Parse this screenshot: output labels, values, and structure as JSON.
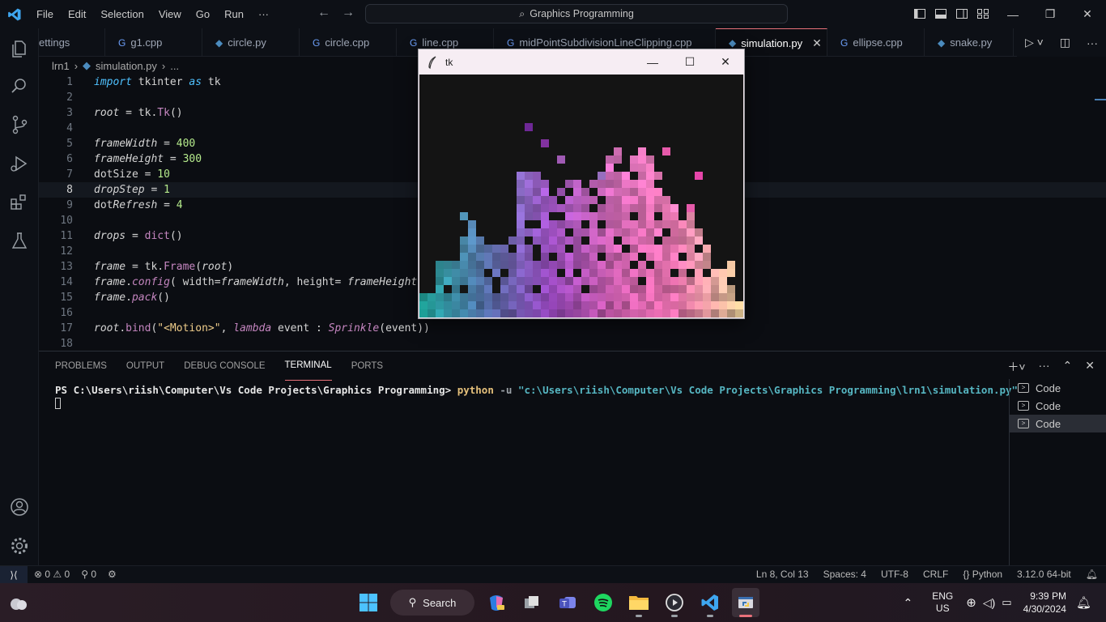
{
  "titlebar": {
    "menu": [
      "File",
      "Edit",
      "Selection",
      "View",
      "Go",
      "Run",
      "···"
    ],
    "search_text": "Graphics Programming"
  },
  "tabs": [
    {
      "label": "ettings",
      "active": false
    },
    {
      "label": "g1.cpp",
      "active": false
    },
    {
      "label": "circle.py",
      "active": false
    },
    {
      "label": "circle.cpp",
      "active": false
    },
    {
      "label": "line.cpp",
      "active": false
    },
    {
      "label": "midPointSubdivisionLineClipping.cpp",
      "active": false
    },
    {
      "label": "simulation.py",
      "active": true
    },
    {
      "label": "ellipse.cpp",
      "active": false
    },
    {
      "label": "snake.py",
      "active": false
    }
  ],
  "breadcrumb": {
    "folder": "lrn1",
    "file": "simulation.py",
    "more": "..."
  },
  "editor": {
    "current_line": 8,
    "lines": [
      {
        "n": "1",
        "html": "<span class='kw'>import</span> tkinter <span class='kw'>as</span> tk"
      },
      {
        "n": "2",
        "html": ""
      },
      {
        "n": "3",
        "html": "<span class='var'>root</span> = tk.<span class='cls'>Tk</span>()"
      },
      {
        "n": "4",
        "html": ""
      },
      {
        "n": "5",
        "html": "<span class='var'>frameWidth</span> = <span class='num'>400</span>"
      },
      {
        "n": "6",
        "html": "<span class='var'>frameHeight</span> = <span class='num'>300</span>"
      },
      {
        "n": "7",
        "html": "dotSize = <span class='num'>10</span>"
      },
      {
        "n": "8",
        "html": "<span class='var'>dropStep</span> = <span class='num'>1</span>"
      },
      {
        "n": "9",
        "html": "dot<span class='var'>Refresh</span> = <span class='num'>4</span>"
      },
      {
        "n": "10",
        "html": ""
      },
      {
        "n": "11",
        "html": "<span class='var'>drops</span> = <span class='cls'>dict</span>()"
      },
      {
        "n": "12",
        "html": ""
      },
      {
        "n": "13",
        "html": "<span class='var'>frame</span> = tk.<span class='cls'>Frame</span>(<span class='var'>root</span>)"
      },
      {
        "n": "14",
        "html": "<span class='var'>frame</span>.<span class='fn ital'>config</span>( width=<span class='var'>frameWidth</span>, height= <span class='var'>frameHeight</span>"
      },
      {
        "n": "15",
        "html": "<span class='var'>frame</span>.<span class='fn ital'>pack</span>()"
      },
      {
        "n": "16",
        "html": ""
      },
      {
        "n": "17",
        "html": "<span class='var'>root</span>.<span class='fn'>bind</span>(<span class='str'>\"&lt;Motion&gt;\"</span>, <span class='fn ital'>lambda</span> event : <span class='fn ital'>Sprinkle</span>(event))"
      },
      {
        "n": "18",
        "html": ""
      }
    ]
  },
  "panel": {
    "tabs": [
      "PROBLEMS",
      "OUTPUT",
      "DEBUG CONSOLE",
      "TERMINAL",
      "PORTS"
    ],
    "active_tab": "TERMINAL",
    "terminal": {
      "prompt": "PS C:\\Users\\riish\\Computer\\Vs Code Projects\\Graphics Programming> ",
      "command": "python",
      "flag": " -u ",
      "path": "\"c:\\Users\\riish\\Computer\\Vs Code Projects\\Graphics Programming\\lrn1\\simulation.py\""
    },
    "terminal_list": [
      "Code",
      "Code",
      "Code"
    ]
  },
  "statusbar": {
    "errors": "0",
    "warnings": "0",
    "ports": "0",
    "position": "Ln 8, Col 13",
    "spaces": "Spaces: 4",
    "encoding": "UTF-8",
    "eol": "CRLF",
    "language": "Python",
    "interpreter": "3.12.0 64-bit"
  },
  "tk_window": {
    "title": "tk"
  },
  "taskbar": {
    "search_label": "Search",
    "lang_top": "ENG",
    "lang_bottom": "US",
    "time": "9:39 PM",
    "date": "4/30/2024"
  },
  "colors": {
    "accent": "#e8717a",
    "bg": "#0b0d12"
  }
}
